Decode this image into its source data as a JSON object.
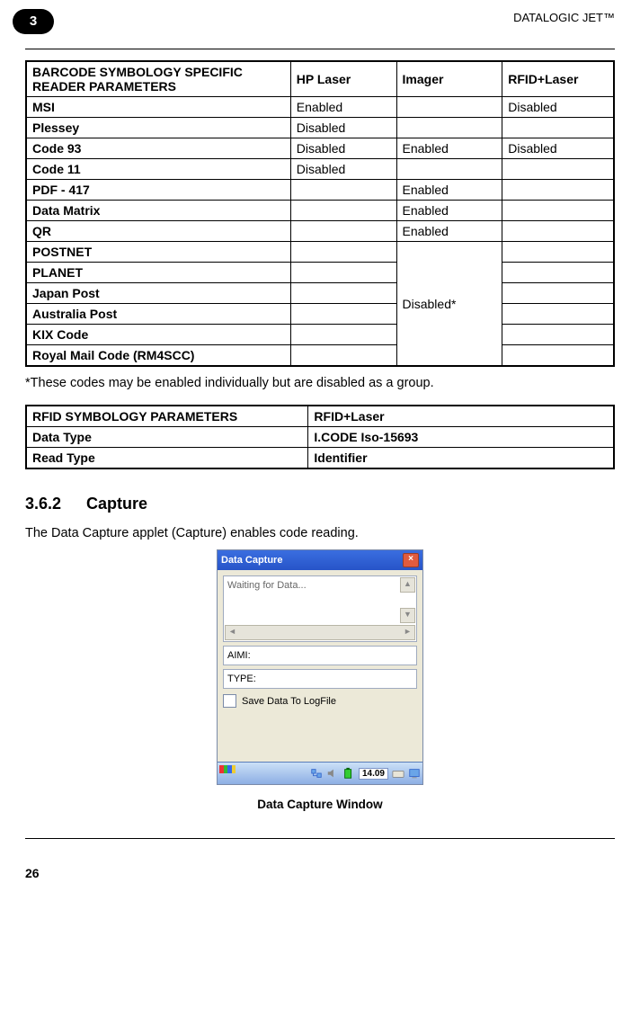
{
  "header": {
    "product": "DATALOGIC JET™",
    "chapter": "3"
  },
  "table1": {
    "headers": [
      "BARCODE SYMBOLOGY SPECIFIC\nREADER PARAMETERS",
      "HP Laser",
      "Imager",
      "RFID+Laser"
    ],
    "rows": [
      {
        "name": "MSI",
        "hp": "Enabled",
        "imager": "",
        "rfid": "Disabled"
      },
      {
        "name": "Plessey",
        "hp": "Disabled",
        "imager": "",
        "rfid": ""
      },
      {
        "name": "Code 93",
        "hp": "Disabled",
        "imager": "Enabled",
        "rfid": "Disabled"
      },
      {
        "name": "Code 11",
        "hp": "Disabled",
        "imager": "",
        "rfid": ""
      },
      {
        "name": "PDF - 417",
        "hp": "",
        "imager": "Enabled",
        "rfid": ""
      },
      {
        "name": "Data Matrix",
        "hp": "",
        "imager": "Enabled",
        "rfid": ""
      },
      {
        "name": "QR",
        "hp": "",
        "imager": "Enabled",
        "rfid": ""
      },
      {
        "name": "POSTNET",
        "hp": "",
        "imager": "",
        "rfid": ""
      },
      {
        "name": "PLANET",
        "hp": "",
        "imager": "",
        "rfid": ""
      },
      {
        "name": "Japan Post",
        "hp": "",
        "imager": "",
        "rfid": ""
      },
      {
        "name": "Australia Post",
        "hp": "",
        "imager": "",
        "rfid": ""
      },
      {
        "name": "KIX Code",
        "hp": "",
        "imager": "",
        "rfid": ""
      },
      {
        "name": "Royal Mail Code (RM4SCC)",
        "hp": "",
        "imager": "",
        "rfid": ""
      }
    ],
    "merged_imager_label": "Disabled*"
  },
  "note": "*These codes may be enabled individually but are disabled as a group.",
  "table2": {
    "header_left": "RFID SYMBOLOGY PARAMETERS",
    "header_right": "RFID+Laser",
    "rows": [
      {
        "k": "Data Type",
        "v": "I.CODE Iso-15693"
      },
      {
        "k": "Read Type",
        "v": "Identifier"
      }
    ]
  },
  "section": {
    "number": "3.6.2",
    "title": "Capture"
  },
  "body": "The Data Capture applet (Capture) enables code reading.",
  "window": {
    "title": "Data Capture",
    "waiting": "Waiting for Data...",
    "aimi": "AIMI:",
    "type": "TYPE:",
    "save_label": "Save Data To LogFile",
    "clock": "14.09"
  },
  "caption": "Data Capture Window",
  "page_number": "26"
}
